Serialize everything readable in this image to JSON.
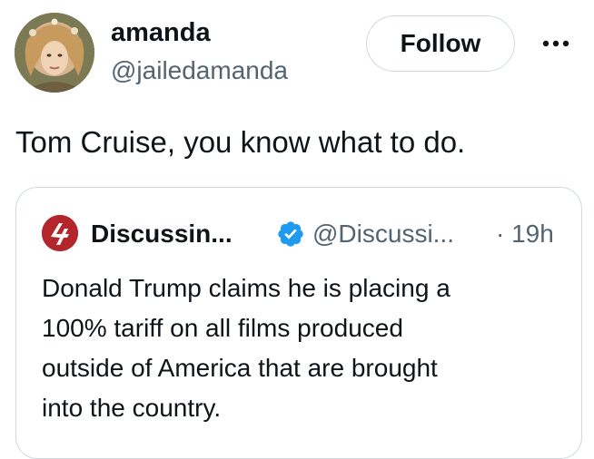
{
  "tweet": {
    "author": {
      "display_name": "amanda",
      "handle": "@jailedamanda",
      "avatar": "user-avatar-photo"
    },
    "follow_label": "Follow",
    "more_icon": "more-horizontal-icon",
    "text": "Tom Cruise, you know what to do."
  },
  "quoted_tweet": {
    "author": {
      "display_name": "Discussin...",
      "handle": "@Discussi...",
      "avatar": "discussing-film-logo-icon",
      "verified_icon": "verified-badge-icon"
    },
    "time": "· 19h",
    "text_lines": [
      "Donald Trump claims he is placing a",
      "100% tariff on all films produced",
      "outside of America that are brought",
      "into the country."
    ]
  },
  "colors": {
    "text_primary": "#0f1419",
    "text_secondary": "#536471",
    "border": "#cfd9de",
    "verified_blue": "#1d9bf0",
    "logo_red": "#b3262b"
  }
}
